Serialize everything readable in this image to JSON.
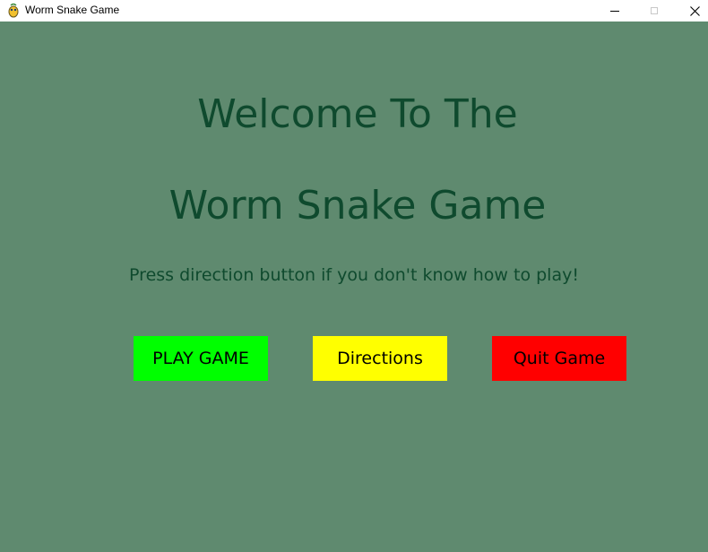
{
  "window": {
    "title": "Worm Snake Game",
    "icon": "pygame-snake-icon",
    "controls": {
      "minimize": "minimize-icon",
      "maximize": "maximize-icon",
      "close": "✕"
    }
  },
  "menu": {
    "heading_line1": "Welcome To The",
    "heading_line2": "Worm Snake Game",
    "subtitle": "Press direction button if you don't know how to play!",
    "buttons": [
      {
        "label": "PLAY GAME",
        "color": "#00ff00"
      },
      {
        "label": "Directions",
        "color": "#ffff00"
      },
      {
        "label": "Quit Game",
        "color": "#ff0000"
      }
    ]
  },
  "colors": {
    "background": "#5f8a6f",
    "heading_text": "#0f4a2e",
    "button_text": "#000000"
  }
}
